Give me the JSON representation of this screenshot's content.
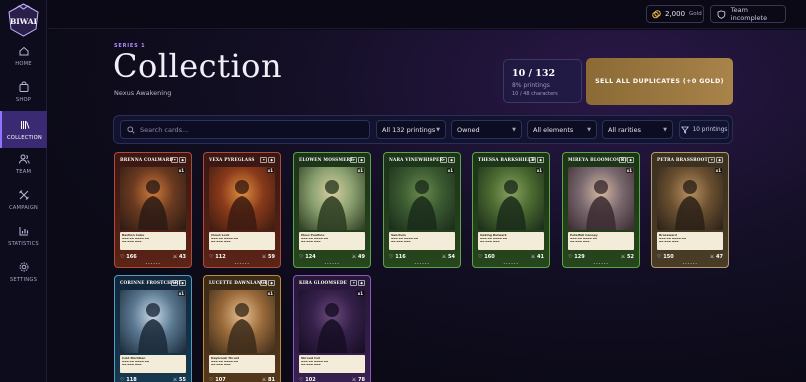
{
  "app": {
    "logo_text": "BIWAI"
  },
  "sidebar": {
    "items": [
      {
        "label": "HOME",
        "icon": "home-icon"
      },
      {
        "label": "SHOP",
        "icon": "shop-icon"
      },
      {
        "label": "COLLECTION",
        "icon": "collection-icon",
        "active": true
      },
      {
        "label": "TEAM",
        "icon": "team-icon"
      },
      {
        "label": "CAMPAIGN",
        "icon": "campaign-icon"
      },
      {
        "label": "STATISTICS",
        "icon": "statistics-icon"
      },
      {
        "label": "SETTINGS",
        "icon": "settings-icon"
      }
    ]
  },
  "topbar": {
    "gold_amount": "2,000",
    "gold_label": "Gold",
    "team_status": "Team incomplete"
  },
  "header": {
    "series": "SERIES 1",
    "title": "Collection",
    "subtitle": "Nexus Awakening"
  },
  "stats": {
    "count": "10 / 132",
    "percent": "8% printings",
    "characters": "10 / 48 characters"
  },
  "sell_button": "SELL ALL DUPLICATES (+0 GOLD)",
  "filters": {
    "search_placeholder": "Search cards...",
    "printings": "All 132 printings",
    "owned": "Owned",
    "elements": "All elements",
    "rarities": "All rarities",
    "printings_button": "10 printings"
  },
  "colors": {
    "accent": "#8e74ff",
    "gold_button": "#a8834a",
    "background": "#0b0a16"
  },
  "cards": [
    {
      "name": "BRENNA COALWARD",
      "cls": "red",
      "count": "x1",
      "hp": "166",
      "atk": "43",
      "ability": "Bastion Cube"
    },
    {
      "name": "VEXA PYREGLASS",
      "cls": "red",
      "count": "x1",
      "hp": "112",
      "atk": "59",
      "ability": "Cloud Lock"
    },
    {
      "name": "ELOWEN MOSSMERE",
      "cls": "green",
      "count": "x1",
      "hp": "124",
      "atk": "49",
      "ability": "Moss Poultice"
    },
    {
      "name": "NARA VINEWHISPER",
      "cls": "green",
      "count": "x1",
      "hp": "116",
      "atk": "54",
      "ability": "Sanctum"
    },
    {
      "name": "THESSA BARKSHIELD",
      "cls": "green",
      "count": "x1",
      "hp": "160",
      "atk": "41",
      "ability": "Oaking Bulwark"
    },
    {
      "name": "MIREYA BLOOMCOURT",
      "cls": "green",
      "count": "x1",
      "hp": "129",
      "atk": "52",
      "ability": "Petalfall Canopy"
    },
    {
      "name": "PETRA BRASSROOT",
      "cls": "tan",
      "count": "x1",
      "hp": "150",
      "atk": "47",
      "ability": "Brassward"
    },
    {
      "name": "CORINNE FROSTCHART",
      "cls": "blue",
      "count": "x1",
      "hp": "118",
      "atk": "55",
      "ability": "Cold Meridian"
    },
    {
      "name": "LUCETTE DAWNLANCE",
      "cls": "orange",
      "count": "x1",
      "hp": "107",
      "atk": "81",
      "ability": "Daybreak Thrust"
    },
    {
      "name": "KIRA GLOOMSEDE",
      "cls": "purple",
      "count": "x1",
      "hp": "102",
      "atk": "78",
      "ability": "Shroud Cut"
    }
  ]
}
